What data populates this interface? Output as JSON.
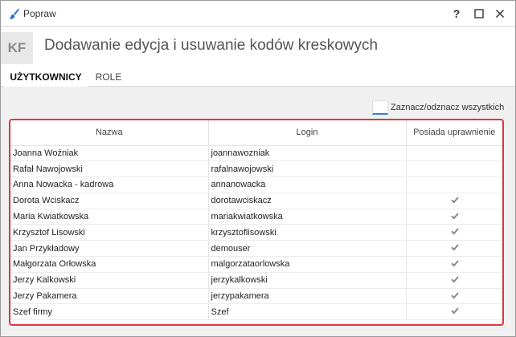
{
  "window": {
    "title": "Popraw",
    "controls": {
      "help": "?",
      "maximize": "maximize-icon",
      "close": "close-icon"
    }
  },
  "header": {
    "badge": "KF",
    "title": "Dodawanie edycja i usuwanie kodów kreskowych"
  },
  "tabs": [
    {
      "label": "UŻYTKOWNICY",
      "active": true
    },
    {
      "label": "ROLE",
      "active": false
    }
  ],
  "select_all": {
    "label": "Zaznacz/odznacz wszystkich",
    "checked": false
  },
  "table": {
    "columns": [
      "Nazwa",
      "Login",
      "Posiada uprawnienie"
    ],
    "rows": [
      {
        "name": "Joanna Woźniak",
        "login": "joannawozniak",
        "has_permission": false
      },
      {
        "name": "Rafał Nawojowski",
        "login": "rafalnawojowski",
        "has_permission": false
      },
      {
        "name": "Anna Nowacka - kadrowa",
        "login": "annanowacka",
        "has_permission": false
      },
      {
        "name": "Dorota Wciskacz",
        "login": "dorotawciskacz",
        "has_permission": true
      },
      {
        "name": "Maria Kwiatkowska",
        "login": "mariakwiatkowska",
        "has_permission": true
      },
      {
        "name": "Krzysztof Lisowski",
        "login": "krzysztoflisowski",
        "has_permission": true
      },
      {
        "name": "Jan Przykładowy",
        "login": "demouser",
        "has_permission": true
      },
      {
        "name": "Małgorzata Orłowska",
        "login": "malgorzataorlowska",
        "has_permission": true
      },
      {
        "name": "Jerzy Kalkowski",
        "login": "jerzykalkowski",
        "has_permission": true
      },
      {
        "name": "Jerzy Pakamera",
        "login": "jerzypakamera",
        "has_permission": true
      },
      {
        "name": "Szef firmy",
        "login": "Szef",
        "has_permission": true
      }
    ]
  },
  "colors": {
    "highlight_border": "#e0343f",
    "checkbox_accent": "#3b7fd0",
    "check_mark": "#888888"
  }
}
